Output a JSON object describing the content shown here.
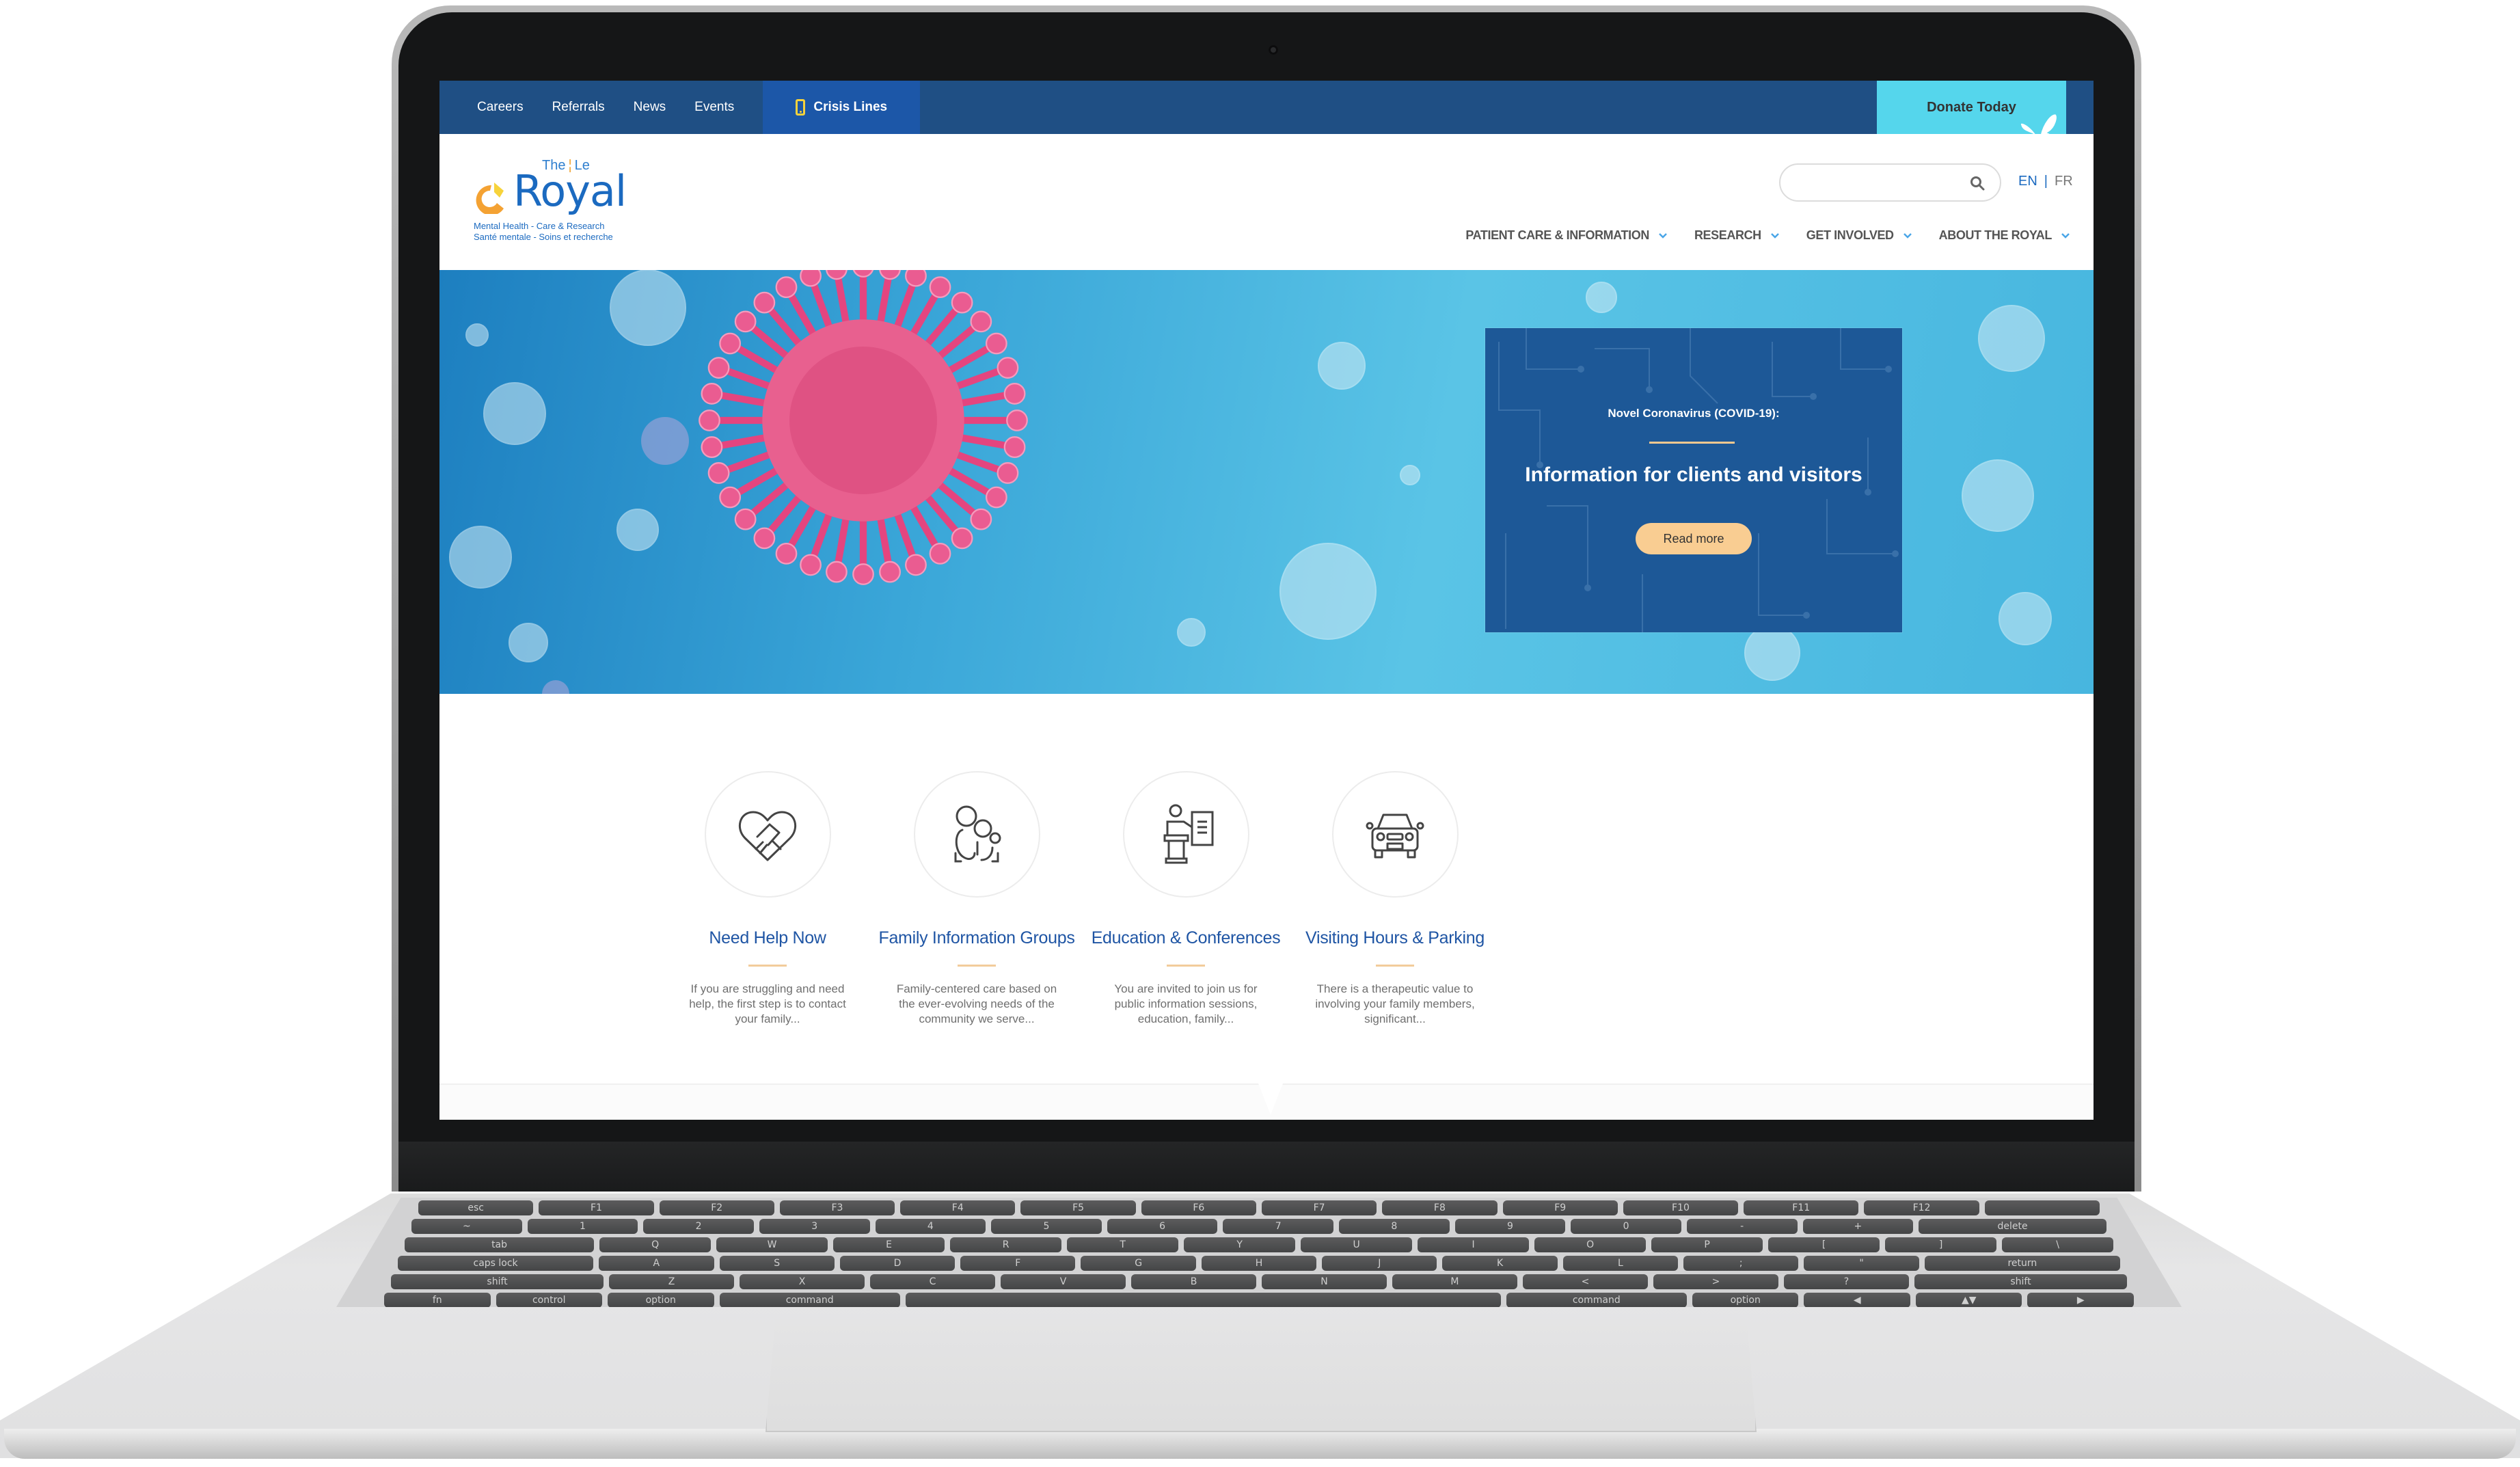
{
  "utility_nav": {
    "links": [
      "Careers",
      "Referrals",
      "News",
      "Events"
    ],
    "crisis_label": "Crisis Lines",
    "crisis_icon": "mobile-phone-icon",
    "donate_label": "Donate Today",
    "donate_icon": "butterfly-icon"
  },
  "logo": {
    "the": "The",
    "le": "Le",
    "name": "Royal",
    "tagline_en": "Mental Health - Care & Research",
    "tagline_fr": "Santé mentale - Soins et recherche"
  },
  "search": {
    "placeholder": "",
    "value": "",
    "icon": "search-icon"
  },
  "language": {
    "en": "EN",
    "separator": "|",
    "fr": "FR",
    "active": "EN"
  },
  "main_nav": [
    {
      "label": "PATIENT CARE & INFORMATION"
    },
    {
      "label": "RESEARCH"
    },
    {
      "label": "GET INVOLVED"
    },
    {
      "label": "ABOUT THE ROYAL"
    }
  ],
  "hero": {
    "kicker": "Novel Coronavirus (COVID-19):",
    "title": "Information for clients and visitors",
    "button_label": "Read more"
  },
  "features": [
    {
      "icon": "handshake-heart-icon",
      "title": "Need Help Now",
      "description": "If you are struggling and need help, the first step is to contact your family..."
    },
    {
      "icon": "family-icon",
      "title": "Family Information Groups",
      "description": "Family-centered care based on the ever-evolving needs of the community we serve..."
    },
    {
      "icon": "presenter-podium-icon",
      "title": "Education & Conferences",
      "description": "You are invited to join us for public information sessions, education, family..."
    },
    {
      "icon": "car-icon",
      "title": "Visiting Hours & Parking",
      "description": "There is a therapeutic value to involving your family members, significant..."
    }
  ],
  "colors": {
    "utility_bar": "#1f4f84",
    "crisis_bg": "#1c57a8",
    "donate_bg": "#55d6ec",
    "brand_blue": "#1b6ac0",
    "accent_peach": "#f9cd92",
    "card_bg": "#1d5897"
  },
  "keyboard": {
    "rows": [
      [
        "esc",
        "F1",
        "F2",
        "F3",
        "F4",
        "F5",
        "F6",
        "F7",
        "F8",
        "F9",
        "F10",
        "F11",
        "F12",
        ""
      ],
      [
        "~",
        "1",
        "2",
        "3",
        "4",
        "5",
        "6",
        "7",
        "8",
        "9",
        "0",
        "-",
        "+",
        "delete"
      ],
      [
        "tab",
        "Q",
        "W",
        "E",
        "R",
        "T",
        "Y",
        "U",
        "I",
        "O",
        "P",
        "[",
        "]",
        "\\"
      ],
      [
        "caps lock",
        "A",
        "S",
        "D",
        "F",
        "G",
        "H",
        "J",
        "K",
        "L",
        ";",
        "\"",
        "return"
      ],
      [
        "shift",
        "Z",
        "X",
        "C",
        "V",
        "B",
        "N",
        "M",
        "<",
        ">",
        "?",
        "shift"
      ],
      [
        "fn",
        "control",
        "option",
        "command",
        "",
        "command",
        "option",
        "◀",
        "▲▼",
        "▶"
      ]
    ]
  }
}
